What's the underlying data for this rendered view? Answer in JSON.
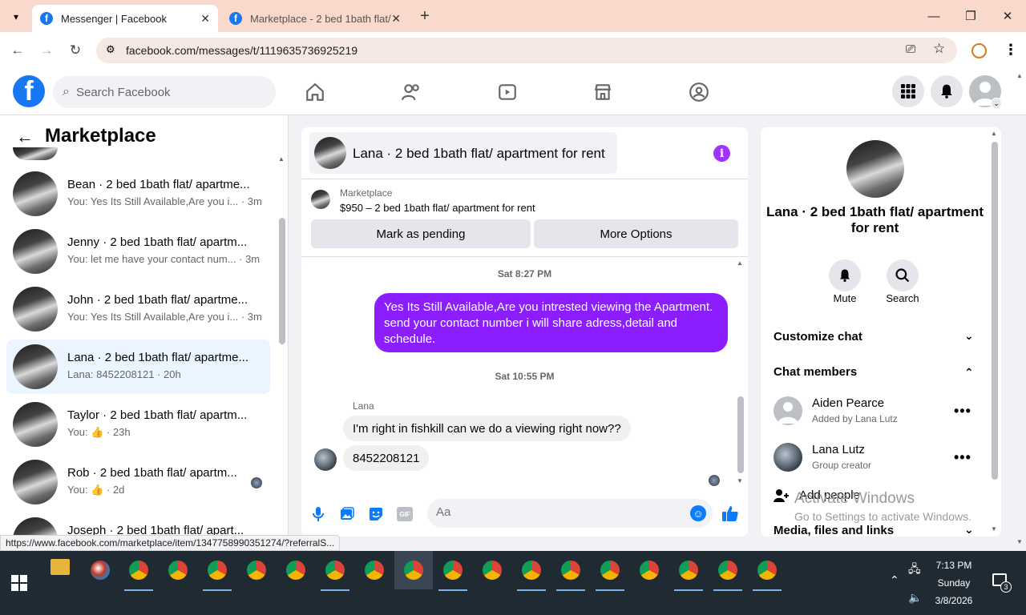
{
  "browser": {
    "tabs": [
      {
        "title": "Messenger | Facebook",
        "active": true
      },
      {
        "title": "Marketplace - 2 bed 1bath flat/",
        "active": false
      }
    ],
    "url": "facebook.com/messages/t/1119635736925219",
    "status_url": "https://www.facebook.com/marketplace/item/1347758990351274/?referralS..."
  },
  "header": {
    "search_placeholder": "Search Facebook"
  },
  "left_panel": {
    "title": "Marketplace",
    "conversations": [
      {
        "name": "Bean · 2 bed 1bath flat/ apartme...",
        "snippet": "You: Yes Its Still Available,Are you i... · 3m",
        "selected": false
      },
      {
        "name": "Jenny · 2 bed 1bath flat/ apartm...",
        "snippet": "You: let me have your contact num... · 3m",
        "selected": false
      },
      {
        "name": "John · 2 bed 1bath flat/ apartme...",
        "snippet": "You: Yes Its Still Available,Are you i... · 3m",
        "selected": false
      },
      {
        "name": "Lana · 2 bed 1bath flat/ apartme...",
        "snippet": "Lana: 8452208121 · 20h",
        "selected": true
      },
      {
        "name": "Taylor · 2 bed 1bath flat/ apartm...",
        "snippet": "You: 👍 · 23h",
        "selected": false
      },
      {
        "name": "Rob · 2 bed 1bath flat/ apartm...",
        "snippet": "You: 👍 · 2d",
        "selected": false
      },
      {
        "name": "Joseph · 2 bed 1bath flat/ apart...",
        "snippet": "",
        "selected": false
      }
    ]
  },
  "chat": {
    "title": "Lana · 2 bed 1bath flat/ apartment for rent",
    "listing_source": "Marketplace",
    "listing_price_title": "$950 – 2 bed 1bath flat/ apartment for rent",
    "mark_pending_label": "Mark as pending",
    "more_options_label": "More Options",
    "time1": "Sat 8:27 PM",
    "outgoing_message": "Yes Its Still Available,Are you intrested viewing the Apartment. send your contact number i will share adress,detail and schedule.",
    "time2": "Sat 10:55 PM",
    "incoming_sender": "Lana",
    "incoming_messages": [
      "I'm right in fishkill can we do a viewing right now??",
      "8452208121"
    ],
    "composer_placeholder": "Aa",
    "gif_label": "GIF"
  },
  "right_panel": {
    "title": "Lana · 2 bed 1bath flat/ apartment for rent",
    "mute_label": "Mute",
    "search_label": "Search",
    "customize_label": "Customize chat",
    "members_label": "Chat members",
    "members": [
      {
        "name": "Aiden Pearce",
        "subtitle": "Added by Lana Lutz"
      },
      {
        "name": "Lana Lutz",
        "subtitle": "Group creator"
      }
    ],
    "add_people_label": "Add people",
    "media_label": "Media, files and links"
  },
  "watermark": {
    "line1": "Activate Windows",
    "line2": "Go to Settings to activate Windows."
  },
  "taskbar": {
    "time": "7:13 PM",
    "day": "Sunday",
    "date": "3/8/2026",
    "notification_count": "3"
  },
  "colors": {
    "accent": "#8c1dff",
    "facebook_blue": "#1877f2",
    "tabstrip": "#f9d9cc",
    "selected_conv": "#ebf5ff"
  }
}
